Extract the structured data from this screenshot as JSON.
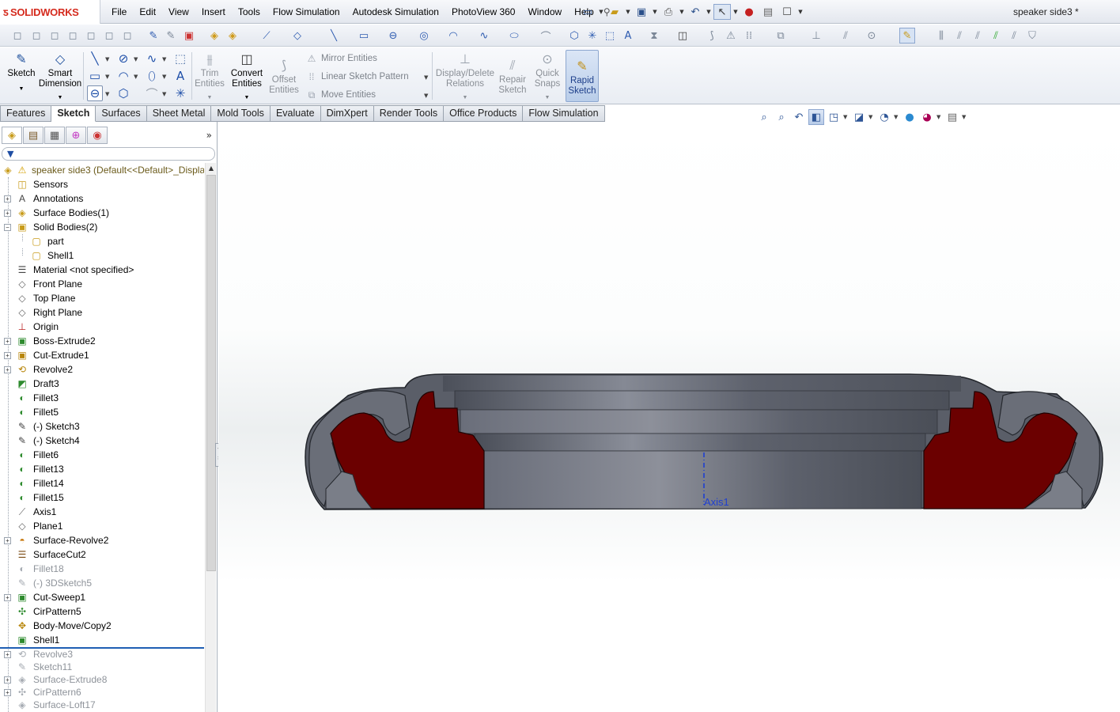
{
  "logo": {
    "brand": "SOLIDWORKS"
  },
  "menus": [
    "File",
    "Edit",
    "View",
    "Insert",
    "Tools",
    "Flow Simulation",
    "Autodesk Simulation",
    "PhotoView 360",
    "Window",
    "Help"
  ],
  "document_title": "speaker side3 *",
  "command_manager": {
    "sketch": "Sketch",
    "smart_dimension_1": "Smart",
    "smart_dimension_2": "Dimension",
    "trim_1": "Trim",
    "trim_2": "Entities",
    "convert_1": "Convert",
    "convert_2": "Entities",
    "offset_1": "Offset",
    "offset_2": "Entities",
    "mirror": "Mirror Entities",
    "linear_pattern": "Linear Sketch Pattern",
    "move": "Move Entities",
    "display_delete_1": "Display/Delete",
    "display_delete_2": "Relations",
    "repair_1": "Repair",
    "repair_2": "Sketch",
    "quick_snaps_1": "Quick",
    "quick_snaps_2": "Snaps",
    "rapid_1": "Rapid",
    "rapid_2": "Sketch"
  },
  "tabs": [
    {
      "label": "Features",
      "active": false
    },
    {
      "label": "Sketch",
      "active": true
    },
    {
      "label": "Surfaces",
      "active": false
    },
    {
      "label": "Sheet Metal",
      "active": false
    },
    {
      "label": "Mold Tools",
      "active": false
    },
    {
      "label": "Evaluate",
      "active": false
    },
    {
      "label": "DimXpert",
      "active": false
    },
    {
      "label": "Render Tools",
      "active": false
    },
    {
      "label": "Office Products",
      "active": false
    },
    {
      "label": "Flow Simulation",
      "active": false
    }
  ],
  "tree": {
    "root": "speaker side3  (Default<<Default>_Displa",
    "items": [
      {
        "label": "Sensors",
        "icon": "sensor-icon",
        "state": "normal",
        "expandable": false
      },
      {
        "label": "Annotations",
        "icon": "annotation-icon",
        "state": "normal",
        "expandable": true
      },
      {
        "label": "Surface Bodies(1)",
        "icon": "surface-bodies-icon",
        "state": "normal",
        "expandable": true
      },
      {
        "label": "Solid Bodies(2)",
        "icon": "solid-bodies-icon",
        "state": "normal",
        "expandable": true,
        "expanded": true
      },
      {
        "label": "part",
        "icon": "body-icon",
        "state": "normal",
        "child": true
      },
      {
        "label": "Shell1",
        "icon": "body-icon",
        "state": "normal",
        "child": true
      },
      {
        "label": "Material <not specified>",
        "icon": "material-icon",
        "state": "normal",
        "expandable": false
      },
      {
        "label": "Front Plane",
        "icon": "plane-icon",
        "state": "normal",
        "expandable": false
      },
      {
        "label": "Top Plane",
        "icon": "plane-icon",
        "state": "normal",
        "expandable": false
      },
      {
        "label": "Right Plane",
        "icon": "plane-icon",
        "state": "normal",
        "expandable": false
      },
      {
        "label": "Origin",
        "icon": "origin-icon",
        "state": "normal",
        "expandable": false
      },
      {
        "label": "Boss-Extrude2",
        "icon": "extrude-icon",
        "state": "normal",
        "expandable": true
      },
      {
        "label": "Cut-Extrude1",
        "icon": "cut-extrude-icon",
        "state": "normal",
        "expandable": true
      },
      {
        "label": "Revolve2",
        "icon": "revolve-icon",
        "state": "normal",
        "expandable": true
      },
      {
        "label": "Draft3",
        "icon": "draft-icon",
        "state": "normal",
        "expandable": false
      },
      {
        "label": "Fillet3",
        "icon": "fillet-icon",
        "state": "normal",
        "expandable": false
      },
      {
        "label": "Fillet5",
        "icon": "fillet-icon",
        "state": "normal",
        "expandable": false
      },
      {
        "label": "(-) Sketch3",
        "icon": "sketch-icon",
        "state": "normal",
        "expandable": false
      },
      {
        "label": "(-) Sketch4",
        "icon": "sketch-icon",
        "state": "normal",
        "expandable": false
      },
      {
        "label": "Fillet6",
        "icon": "fillet-icon",
        "state": "normal",
        "expandable": false
      },
      {
        "label": "Fillet13",
        "icon": "fillet-icon",
        "state": "normal",
        "expandable": false
      },
      {
        "label": "Fillet14",
        "icon": "fillet-icon",
        "state": "normal",
        "expandable": false
      },
      {
        "label": "Fillet15",
        "icon": "fillet-icon",
        "state": "normal",
        "expandable": false
      },
      {
        "label": "Axis1",
        "icon": "axis-icon",
        "state": "normal",
        "expandable": false
      },
      {
        "label": "Plane1",
        "icon": "plane-icon",
        "state": "normal",
        "expandable": false
      },
      {
        "label": "Surface-Revolve2",
        "icon": "surface-revolve-icon",
        "state": "normal",
        "expandable": true
      },
      {
        "label": "SurfaceCut2",
        "icon": "surface-cut-icon",
        "state": "normal",
        "expandable": false
      },
      {
        "label": "Fillet18",
        "icon": "fillet-icon",
        "state": "suppressed",
        "expandable": false
      },
      {
        "label": "(-) 3DSketch5",
        "icon": "3dsketch-icon",
        "state": "suppressed",
        "expandable": false
      },
      {
        "label": "Cut-Sweep1",
        "icon": "cut-sweep-icon",
        "state": "normal",
        "expandable": true
      },
      {
        "label": "CirPattern5",
        "icon": "circular-pattern-icon",
        "state": "normal",
        "expandable": false
      },
      {
        "label": "Body-Move/Copy2",
        "icon": "move-copy-icon",
        "state": "normal",
        "expandable": false
      },
      {
        "label": "Shell1",
        "icon": "shell-icon",
        "state": "normal",
        "expandable": false
      },
      {
        "label": "Revolve3",
        "icon": "revolve-icon",
        "state": "rolled",
        "expandable": true
      },
      {
        "label": "Sketch11",
        "icon": "sketch-icon",
        "state": "rolled",
        "expandable": false
      },
      {
        "label": "Surface-Extrude8",
        "icon": "surface-extrude-icon",
        "state": "rolled",
        "expandable": true
      },
      {
        "label": "CirPattern6",
        "icon": "circular-pattern-icon",
        "state": "rolled",
        "expandable": true
      },
      {
        "label": "Surface-Loft17",
        "icon": "loft-icon",
        "state": "rolled",
        "expandable": false
      }
    ]
  },
  "viewport": {
    "axis_label": "Axis1"
  },
  "colors": {
    "accent": "#1f5fb4",
    "section": "#6b0000",
    "model": "#636876"
  }
}
